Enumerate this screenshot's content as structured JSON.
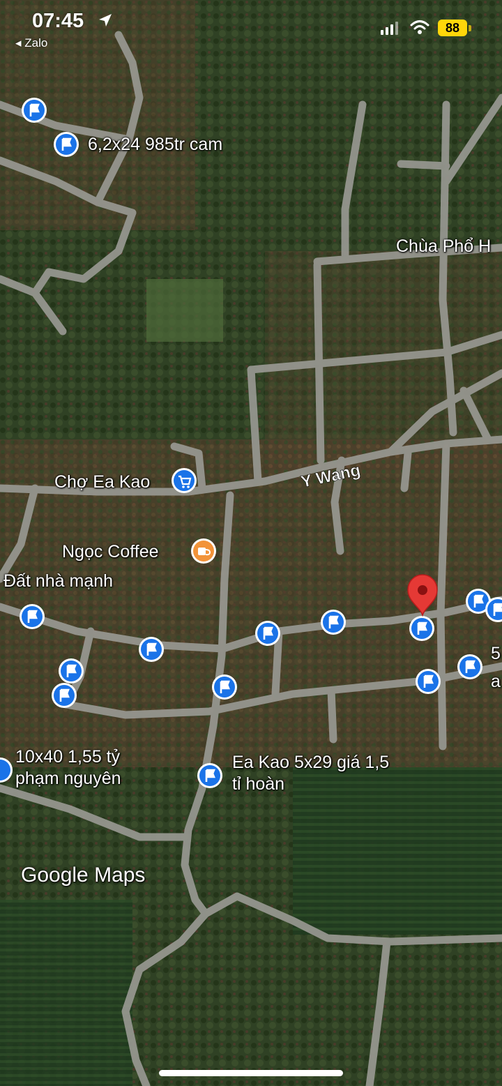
{
  "status_bar": {
    "time": "07:45",
    "back_app": "◂ Zalo",
    "battery": "88"
  },
  "map": {
    "road_label": "Y Wang",
    "places": [
      {
        "name": "Chợ Ea Kao",
        "icon": "cart-icon",
        "color": "#1a73e8"
      },
      {
        "name": "Ngọc Coffee",
        "icon": "coffee-icon",
        "color": "#f29339"
      },
      {
        "name": "Chùa Phổ H"
      }
    ],
    "saved_labels": {
      "lot1": "6,2x24 985tr cam",
      "lot2": "Đất nhà mạnh",
      "lot3_line1": "10x40 1,55 tỷ",
      "lot3_line2": "phạm nguyên",
      "lot4_line1": "Ea Kao 5x29 giá 1,5",
      "lot4_line2": "tỉ hoàn",
      "lot5_a": "5",
      "lot5_b": "a"
    },
    "logo": "Google Maps",
    "colors": {
      "flag_pin": "#1a73e8",
      "selected_pin": "#e53935"
    }
  }
}
